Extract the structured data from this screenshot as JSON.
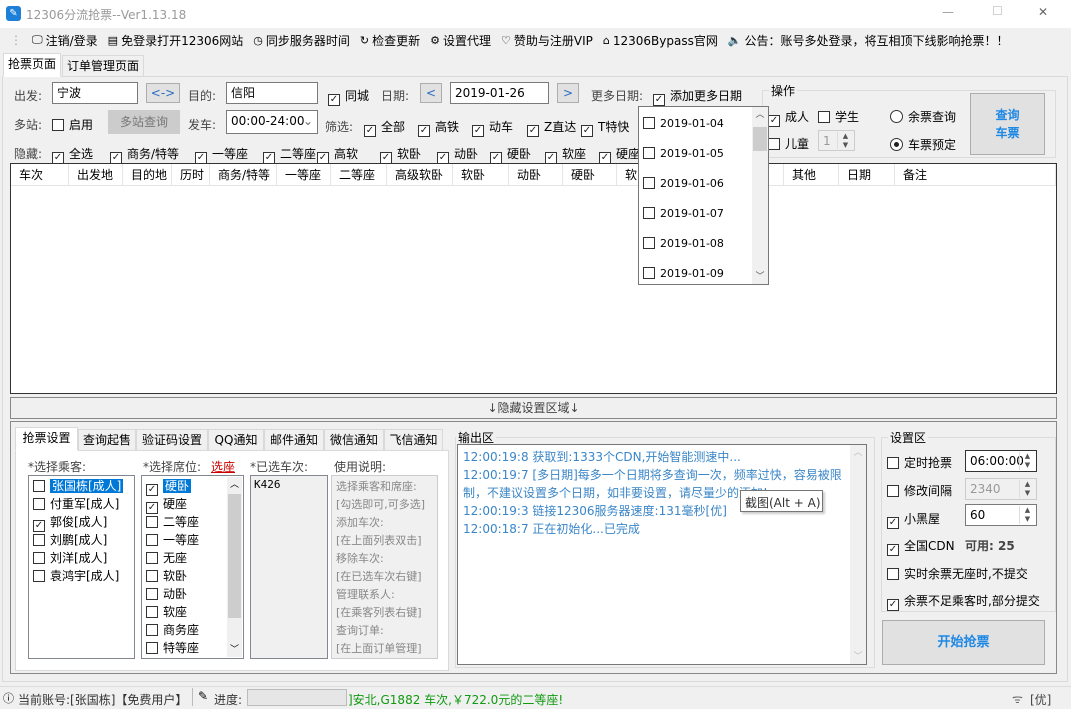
{
  "window": {
    "title": "12306分流抢票--Ver1.13.18",
    "min": "—",
    "max": "☐",
    "close": "✕"
  },
  "toolbar": [
    {
      "icon": "monitor-icon",
      "glyph": "🖵",
      "label": "注销/登录"
    },
    {
      "icon": "browser-icon",
      "glyph": "▤",
      "label": "免登录打开12306网站"
    },
    {
      "icon": "clock-icon",
      "glyph": "◷",
      "label": "同步服务器时间"
    },
    {
      "icon": "refresh-icon",
      "glyph": "↻",
      "label": "检查更新"
    },
    {
      "icon": "gear-icon",
      "glyph": "⚙",
      "label": "设置代理"
    },
    {
      "icon": "heart-icon",
      "glyph": "♡",
      "label": "赞助与注册VIP"
    },
    {
      "icon": "home-icon",
      "glyph": "⌂",
      "label": "12306Bypass官网"
    },
    {
      "icon": "speaker-icon",
      "glyph": "🔈",
      "label": "公告：账号多处登录，将互相顶下线影响抢票！！"
    }
  ],
  "tabs": [
    "抢票页面",
    "订单管理页面"
  ],
  "query": {
    "from_label": "出发:",
    "from": "宁波",
    "swap": "<->",
    "to_label": "目的:",
    "to": "信阳",
    "same_city": "同城",
    "date_label": "日期:",
    "prev": "<",
    "date": "2019-01-26",
    "next": ">",
    "more_dates_label": "更多日期:",
    "add_more_dates": "添加更多日期",
    "multi_label": "多站:",
    "multi_enable": "启用",
    "multi_query": "多站查询",
    "depart_label": "发车:",
    "depart": "00:00-24:00",
    "filter_label": "筛选:",
    "filters": [
      "全部",
      "高铁",
      "动车",
      "Z直达",
      "T特快"
    ],
    "hide_label": "隐藏:",
    "hide": [
      "全选",
      "商务/特等",
      "一等座",
      "二等座",
      "高软",
      "软卧",
      "动卧",
      "硬卧",
      "软座",
      "硬座"
    ]
  },
  "ops": {
    "title": "操作",
    "adult": "成人",
    "student": "学生",
    "child": "儿童",
    "child_count": "1",
    "radio_remain": "余票查询",
    "radio_book": "车票预定",
    "query_btn_1": "查询",
    "query_btn_2": "车票"
  },
  "date_dropdown": [
    "2019-01-04",
    "2019-01-05",
    "2019-01-06",
    "2019-01-07",
    "2019-01-08",
    "2019-01-09"
  ],
  "table_headers": [
    "车次",
    "出发地",
    "目的地",
    "历时",
    "商务/特等",
    "一等座",
    "二等座",
    "高级软卧",
    "软卧",
    "动卧",
    "硬卧",
    "软",
    "其他",
    "日期",
    "备注"
  ],
  "hidden_bar": "↓隐藏设置区域↓",
  "bottom_tabs": [
    "抢票设置",
    "查询起售",
    "验证码设置",
    "QQ通知",
    "邮件通知",
    "微信通知",
    "飞信通知"
  ],
  "settings": {
    "passenger_label": "*选择乘客:",
    "seat_label": "*选择席位:",
    "seat_link": "选座",
    "trains_label": "*已选车次:",
    "help_label": "使用说明:",
    "passengers": [
      {
        "name": "张国栋[成人]",
        "checked": false
      },
      {
        "name": "付重军[成人]",
        "checked": false
      },
      {
        "name": "郭俊[成人]",
        "checked": true
      },
      {
        "name": "刘鹏[成人]",
        "checked": false
      },
      {
        "name": "刘洋[成人]",
        "checked": false
      },
      {
        "name": "袁鸿宇[成人]",
        "checked": false
      }
    ],
    "seats": [
      {
        "name": "硬卧",
        "checked": true
      },
      {
        "name": "硬座",
        "checked": true
      },
      {
        "name": "二等座",
        "checked": false
      },
      {
        "name": "一等座",
        "checked": false
      },
      {
        "name": "无座",
        "checked": false
      },
      {
        "name": "软卧",
        "checked": false
      },
      {
        "name": "动卧",
        "checked": false
      },
      {
        "name": "软座",
        "checked": false
      },
      {
        "name": "商务座",
        "checked": false
      },
      {
        "name": "特等座",
        "checked": false
      }
    ],
    "trains": [
      "K426"
    ],
    "help": [
      "选择乘客和席座:",
      "[勾选即可,可多选]",
      "添加车次:",
      "[在上面列表双击]",
      "移除车次:",
      "[在已选车次右键]",
      "管理联系人:",
      "[在乘客列表右键]",
      "查询订单:",
      "[在上面订单管理]"
    ]
  },
  "output": {
    "title": "输出区",
    "lines": [
      "12:00:19:8  获取到:1333个CDN,开始智能测速中...",
      "12:00:19:7  [多日期]每多一个日期将多查询一次，频率过快，容易被限制，不建议设置多个日期，如非要设置，请尽量少的添加!",
      "12:00:19:3  链接12306服务器速度:131毫秒[优]",
      "12:00:18:7  正在初始化...已完成"
    ],
    "tooltip": "截图(Alt + A)"
  },
  "config": {
    "title": "设置区",
    "timed": "定时抢票",
    "timed_value": "06:00:00",
    "interval": "修改间隔",
    "interval_value": "2340",
    "blackroom": "小黑屋",
    "blackroom_value": "60",
    "cdn": "全国CDN",
    "cdn_avail": "可用: 25",
    "realtime": "实时余票无座时,不提交",
    "partial": "余票不足乘客时,部分提交",
    "start": "开始抢票"
  },
  "status": {
    "account": "当前账号:[张国栋]【免费用户】",
    "progress_label": "进度:",
    "progress": 0,
    "message": "]安北,G1882 车次,￥722.0元的二等座!",
    "signal": "[优]"
  },
  "colors": {
    "accent": "#1e88e5",
    "log": "#3a86c8",
    "status_green": "#109a10",
    "selection": "#0078d7"
  }
}
